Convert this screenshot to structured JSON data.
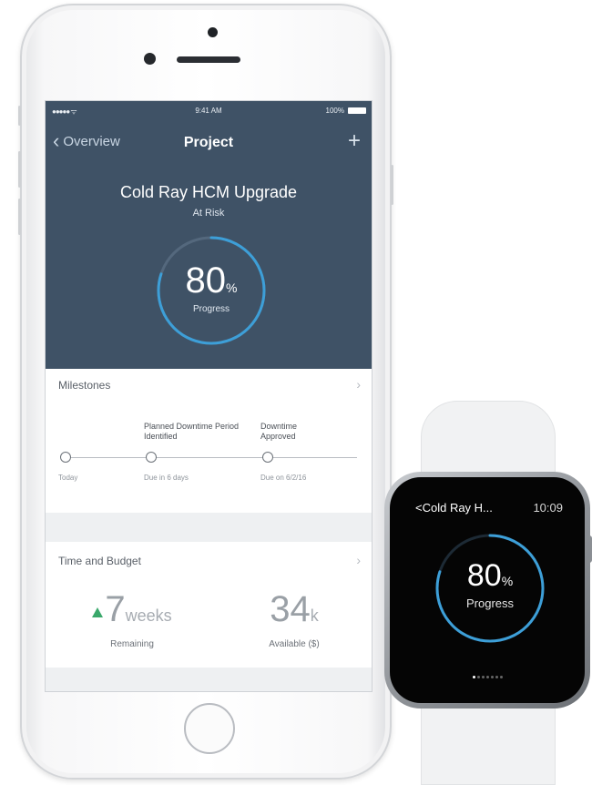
{
  "status_bar": {
    "signal": "●●●●● ᯤ",
    "time": "9:41 AM",
    "battery": "100%"
  },
  "nav": {
    "back_label": "Overview",
    "title": "Project",
    "add_label": "+"
  },
  "project": {
    "name": "Cold Ray HCM Upgrade",
    "status": "At Risk"
  },
  "progress": {
    "value": "80",
    "unit": "%",
    "label": "Progress",
    "fraction": 0.8
  },
  "milestones": {
    "title": "Milestones",
    "items": [
      {
        "title": "",
        "due": "Today"
      },
      {
        "title": "Planned Downtime Period Identified",
        "due": "Due in 6 days"
      },
      {
        "title": "Downtime Approved",
        "due": "Due on 6/2/16"
      }
    ]
  },
  "time_budget": {
    "title": "Time and Budget",
    "remaining": {
      "value": "7",
      "unit": "weeks",
      "label": "Remaining"
    },
    "available": {
      "value": "34",
      "unit": "k",
      "label": "Available ($)"
    }
  },
  "watch": {
    "title": "<Cold Ray H...",
    "time": "10:09",
    "progress_value": "80",
    "progress_unit": "%",
    "progress_label": "Progress"
  },
  "colors": {
    "header_bg": "#3f5266",
    "accent_ring": "#3d9fd8",
    "trend_up": "#3aa86b",
    "watch_bg": "#050505"
  }
}
